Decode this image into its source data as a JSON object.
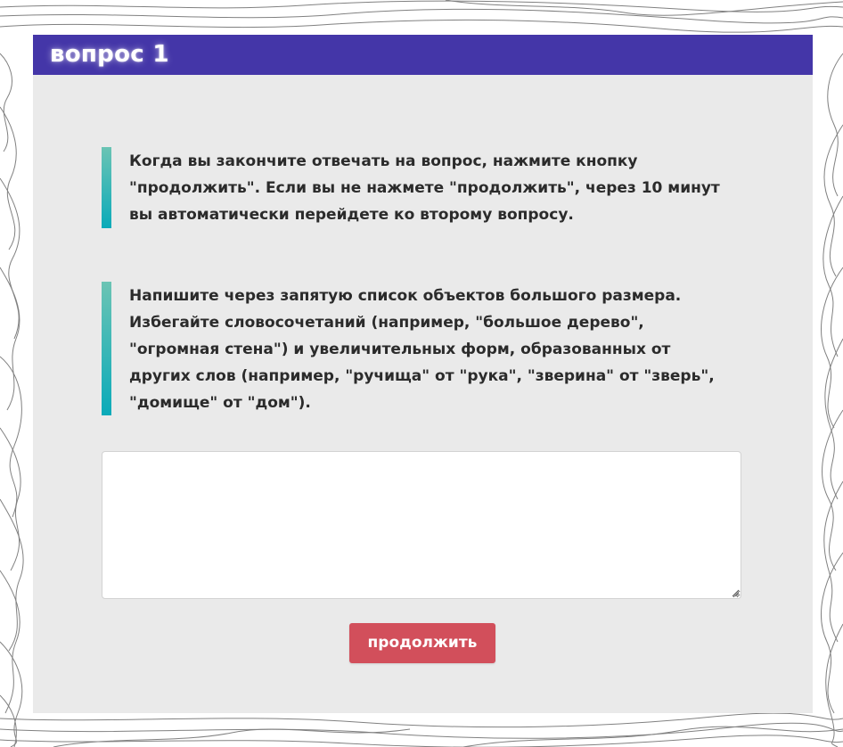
{
  "question": {
    "title": "вопрос 1"
  },
  "instructions": {
    "timer_notice": "Когда вы закончите отвечать на вопрос, нажмите кнопку \"продолжить\". Если вы не нажмете \"продолжить\", через 10 минут вы автоматически перейдете ко второму вопросу.",
    "task_text": "Напишите через запятую список объектов большого размера. Избегайте словосочетаний (например, \"большое дерево\", \"огромная стена\") и увеличительных форм, образованных от других слов (например, \"ручища\" от \"рука\", \"зверина\" от \"зверь\", \"домище\" от \"дом\")."
  },
  "answer": {
    "value": "",
    "placeholder": ""
  },
  "actions": {
    "continue_label": "продолжить"
  },
  "colors": {
    "header": "#4436a8",
    "card_background": "#eaeaea",
    "accent_bar_top": "#6cc4b4",
    "accent_bar_bottom": "#0aaab9",
    "continue_button": "#d24f5b",
    "text": "#2b2b2b"
  },
  "icons": {
    "resize_handle": "resize-grip-icon"
  }
}
